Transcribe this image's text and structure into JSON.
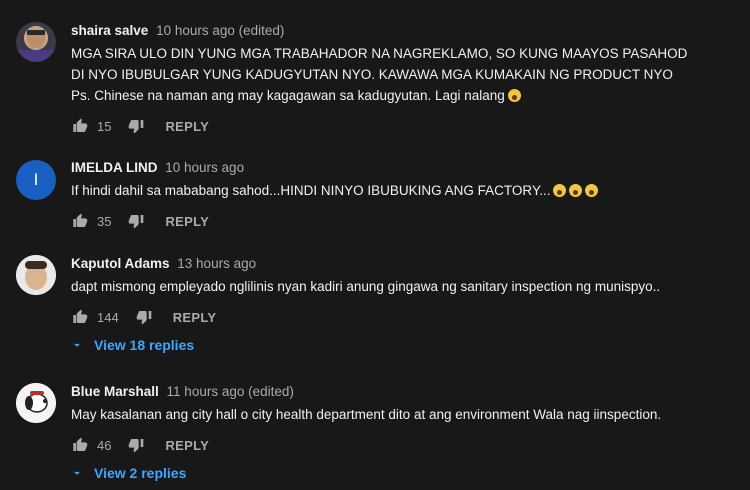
{
  "comments": [
    {
      "author": "shaira salve",
      "time": "10 hours ago (edited)",
      "lines": [
        "MGA SIRA ULO DIN YUNG MGA TRABAHADOR NA NAGREKLAMO,  SO KUNG MAAYOS PASAHOD",
        "DI NYO IBUBULGAR YUNG KADUGYUTAN NYO. KAWAWA MGA KUMAKAIN NG PRODUCT NYO",
        "Ps. Chinese na naman ang may kagagawan sa kadugyutan. Lagi nalang"
      ],
      "likes": "15",
      "reply_label": "REPLY",
      "avatar_icon": "user-photo-avatar"
    },
    {
      "author": "IMELDA LIND",
      "time": "10 hours ago",
      "avatar_letter": "I",
      "lines": [
        "If hindi dahil sa mababang sahod...HINDI NINYO IBUBUKING ANG FACTORY..."
      ],
      "likes": "35",
      "reply_label": "REPLY"
    },
    {
      "author": "Kaputol Adams",
      "time": "13 hours ago",
      "lines": [
        "dapt mismong empleyado nglilinis nyan kadiri anung gingawa ng sanitary inspection ng munispyo.."
      ],
      "likes": "144",
      "reply_label": "REPLY",
      "view_replies": "View 18 replies",
      "avatar_icon": "user-photo-avatar"
    },
    {
      "author": "Blue Marshall",
      "time": "11 hours ago (edited)",
      "lines": [
        "May kasalanan ang city hall o city health department dito at ang environment Wala nag iinspection."
      ],
      "likes": "46",
      "reply_label": "REPLY",
      "view_replies": "View 2 replies",
      "avatar_icon": "snoopy-avatar"
    }
  ],
  "colors": {
    "background": "#181818",
    "text": "#f1f1f1",
    "secondary": "#aaaaaa",
    "link": "#3ea6ff"
  }
}
